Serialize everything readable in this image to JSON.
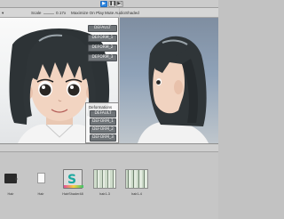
{
  "toolbar": {
    "play_icon": "play-icon",
    "pause_icon": "pause-icon",
    "step_icon": "step-icon"
  },
  "game": {
    "scale_label": "Scale",
    "scale_value": "0.17x",
    "maximize_label": "Maximize On Play",
    "mute_label": "Mute Audio",
    "shaded_label": "Shaded",
    "deform_buttons": [
      "DEFAULT",
      "DEFORM_1",
      "DEFORM_2",
      "DEFORM_3"
    ],
    "deform_panel_title": "Deformations",
    "deform_panel_items": [
      "DEFAULT",
      "DEFORM_1",
      "DEFORM_2",
      "DEFORM_3"
    ]
  },
  "scene": {
    "tab_label": "Scene"
  },
  "project": {
    "assets": [
      {
        "label": "Hair",
        "icon": "black-mesh-icon"
      },
      {
        "label": "Hair",
        "icon": "white-file-icon"
      },
      {
        "label": "HairShader48",
        "icon": "shader-icon"
      },
      {
        "label": "hair1-3",
        "icon": "texture-icon"
      },
      {
        "label": "hair1-4",
        "icon": "texture-icon"
      }
    ]
  },
  "colors": {
    "play_active": "#2d86e0",
    "button_bg": "#6f7478"
  }
}
